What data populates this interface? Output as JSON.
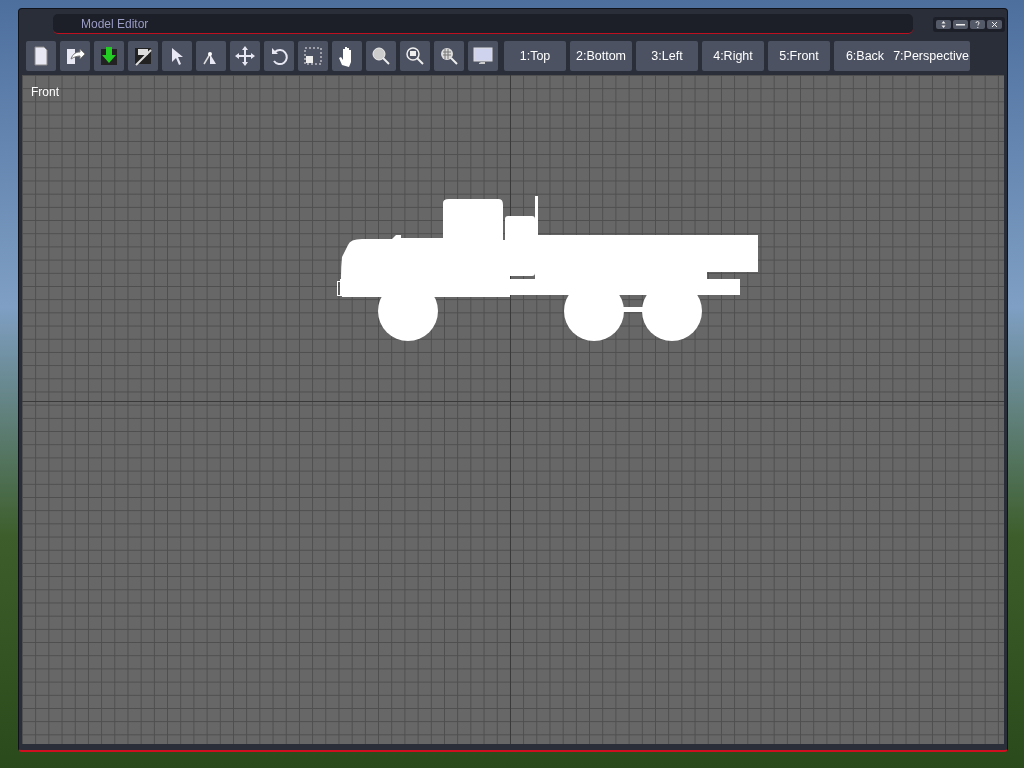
{
  "window": {
    "title": "Model Editor"
  },
  "view_buttons": [
    {
      "label": "1:Top"
    },
    {
      "label": "2:Bottom"
    },
    {
      "label": "3:Left"
    },
    {
      "label": "4:Right"
    },
    {
      "label": "5:Front"
    },
    {
      "label": "6:Back"
    },
    {
      "label": "7:Perspective"
    }
  ],
  "viewport": {
    "label": "Front"
  }
}
